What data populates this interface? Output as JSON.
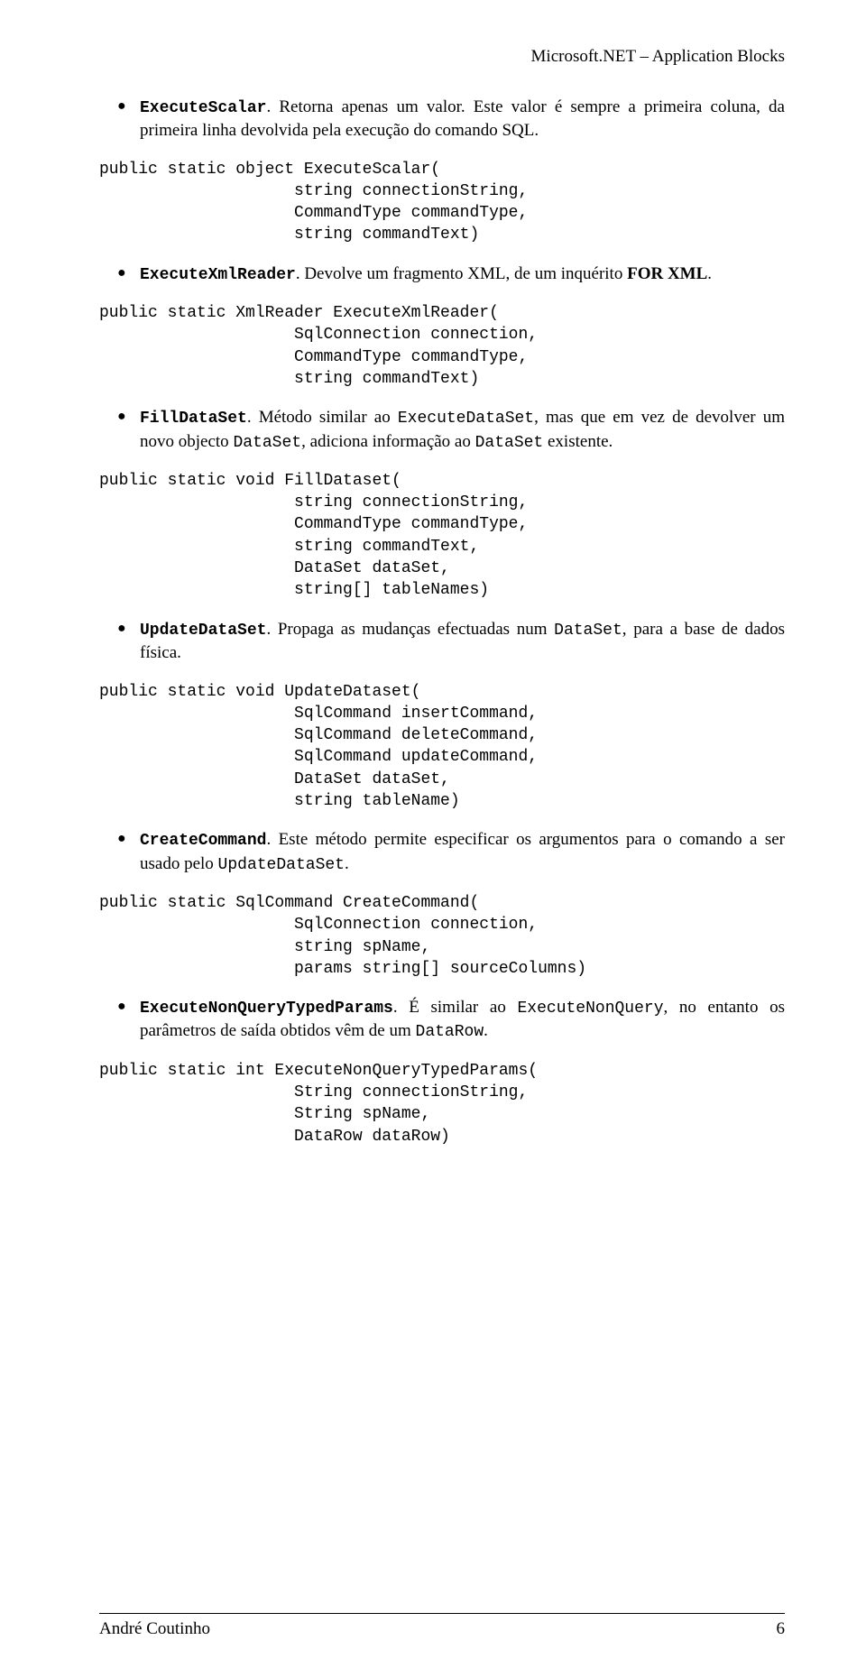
{
  "header": {
    "title": "Microsoft.NET – Application Blocks"
  },
  "items": [
    {
      "name": "ExecuteScalar",
      "desc_before": ". Retorna apenas um valor. Este valor é sempre a primeira coluna, da primeira linha devolvida pela execução do comando SQL.",
      "code": "public static object ExecuteScalar(\n                    string connectionString,\n                    CommandType commandType,\n                    string commandText)"
    },
    {
      "name": "ExecuteXmlReader",
      "desc_before": ". Devolve um fragmento XML, de um inquérito ",
      "bold_tail": "FOR XML",
      "desc_after": ".",
      "code": "public static XmlReader ExecuteXmlReader(\n                    SqlConnection connection,\n                    CommandType commandType,\n                    string commandText)"
    },
    {
      "name": "FillDataSet",
      "desc_before": ". Método similar ao ",
      "code_inline_1": "ExecuteDataSet",
      "desc_mid": ", mas que em vez de devolver um novo objecto ",
      "code_inline_2": "DataSet",
      "desc_mid2": ", adiciona informação ao ",
      "code_inline_3": "DataSet",
      "desc_after": " existente.",
      "code": "public static void FillDataset(\n                    string connectionString,\n                    CommandType commandType,\n                    string commandText,\n                    DataSet dataSet,\n                    string[] tableNames)"
    },
    {
      "name": "UpdateDataSet",
      "desc_before": ". Propaga as mudanças efectuadas num ",
      "code_inline_1": "DataSet",
      "desc_after": ", para a base de dados física.",
      "code": "public static void UpdateDataset(\n                    SqlCommand insertCommand,\n                    SqlCommand deleteCommand,\n                    SqlCommand updateCommand,\n                    DataSet dataSet,\n                    string tableName)"
    },
    {
      "name": "CreateCommand",
      "desc_before": ". Este método permite especificar os argumentos para o comando a ser usado pelo ",
      "code_inline_1": "UpdateDataSet",
      "desc_after": ".",
      "code": "public static SqlCommand CreateCommand(\n                    SqlConnection connection,\n                    string spName,\n                    params string[] sourceColumns)"
    },
    {
      "name": "ExecuteNonQueryTypedParams",
      "desc_before": ". É similar ao ",
      "code_inline_1": "ExecuteNonQuery",
      "desc_mid": ", no entanto os parâmetros de saída obtidos vêm de um ",
      "code_inline_2": "DataRow",
      "desc_after": ".",
      "code": "public static int ExecuteNonQueryTypedParams(\n                    String connectionString,\n                    String spName,\n                    DataRow dataRow)"
    }
  ],
  "footer": {
    "author": "André Coutinho",
    "page": "6"
  }
}
